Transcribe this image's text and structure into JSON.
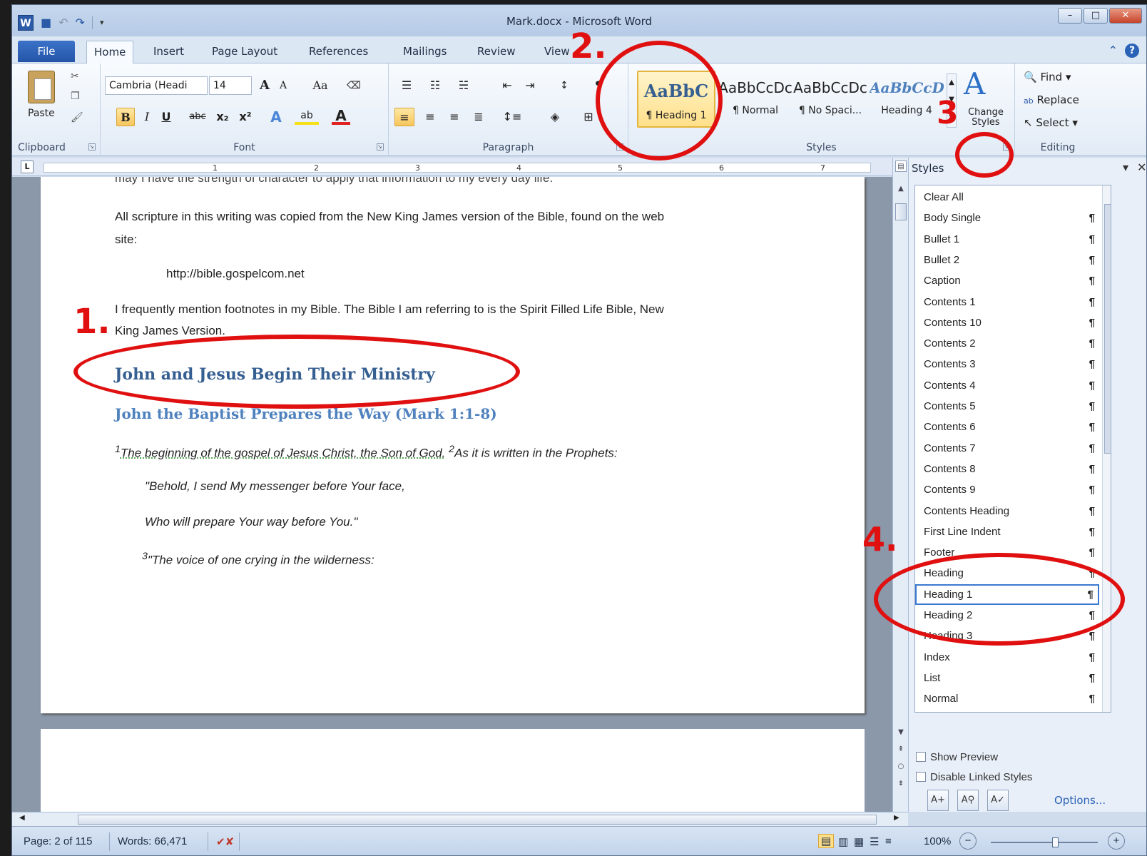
{
  "window": {
    "title": "Mark.docx - Microsoft Word"
  },
  "icons": [
    "word-logo-icon",
    "save-icon",
    "undo-icon",
    "redo-icon",
    "customize-qat-icon",
    "minimize-icon",
    "maximize-icon",
    "close-icon",
    "ribbon-collapse-icon",
    "help-icon"
  ],
  "tabs": [
    "File",
    "Home",
    "Insert",
    "Page Layout",
    "References",
    "Mailings",
    "Review",
    "View"
  ],
  "ribbon": {
    "clipboard": {
      "paste_label": "Paste",
      "group_label": "Clipboard"
    },
    "font": {
      "font_name": "Cambria (Headi",
      "font_size": "14",
      "group_label": "Font",
      "grow": "A",
      "shrink": "A",
      "case": "Aa",
      "bold": "B",
      "italic": "I",
      "underline": "U",
      "strike": "abc",
      "subscript": "x₂",
      "superscript": "x²",
      "effects": "A",
      "highlight": "ab",
      "color": "A"
    },
    "paragraph": {
      "group_label": "Paragraph"
    },
    "styles": {
      "group_label": "Styles",
      "gallery": [
        {
          "sample": "AaBbC",
          "name": "¶ Heading 1",
          "selected": true
        },
        {
          "sample": "AaBbCcDc",
          "name": "¶ Normal"
        },
        {
          "sample": "AaBbCcDc",
          "name": "¶ No Spaci..."
        },
        {
          "sample": "AaBbCcD",
          "name": "Heading 4"
        }
      ],
      "change_styles": "Change Styles"
    },
    "editing": {
      "group_label": "Editing",
      "find": "Find",
      "replace": "Replace",
      "select": "Select"
    }
  },
  "ruler": {
    "numbers": [
      "1",
      "2",
      "3",
      "4",
      "5",
      "6",
      "7"
    ]
  },
  "document": {
    "line_partial": "may I have the strength of character to apply that information to my every day life.",
    "p1a": "All scripture in this writing was copied from the New King James version of the Bible, found on the web",
    "p1b": "site:",
    "url": "http://bible.gospelcom.net",
    "p2a": "I frequently mention footnotes in my Bible.  The Bible I am referring to is the Spirit Filled Life Bible, New",
    "p2b": "King James Version.",
    "heading1": "John and Jesus Begin Their Ministry",
    "heading2": "John the Baptist Prepares the Way (Mark 1:1-8)",
    "verse1_num": "1",
    "verse1": "The beginning of the gospel of Jesus Christ, the Son of God.",
    "verse2_num": "2",
    "verse2": "As it is written in the Prophets:",
    "quote1": "\"Behold, I send My messenger before Your face,",
    "quote2": "Who will prepare Your way before You.\"",
    "verse3_num": "3",
    "verse3": "\"The voice of one crying in the wilderness:"
  },
  "annotations": {
    "n1": "1.",
    "n2": "2.",
    "n3": "3",
    "n4": "4."
  },
  "styles_pane": {
    "title": "Styles",
    "items": [
      "Clear All",
      "Body Single",
      "Bullet 1",
      "Bullet 2",
      "Caption",
      "Contents 1",
      "Contents 10",
      "Contents 2",
      "Contents 3",
      "Contents 4",
      "Contents 5",
      "Contents 6",
      "Contents 7",
      "Contents 8",
      "Contents 9",
      "Contents Heading",
      "First Line Indent",
      "Footer",
      "Heading",
      "Heading 1",
      "Heading 2",
      "Heading 3",
      "Index",
      "List",
      "Normal"
    ],
    "selected": "Heading 1",
    "pilcrow": "¶",
    "show_preview": "Show Preview",
    "disable_linked": "Disable Linked Styles",
    "options": "Options..."
  },
  "status": {
    "page": "Page: 2 of 115",
    "words": "Words: 66,471",
    "zoom": "100%",
    "zoom_level": 0.6
  }
}
